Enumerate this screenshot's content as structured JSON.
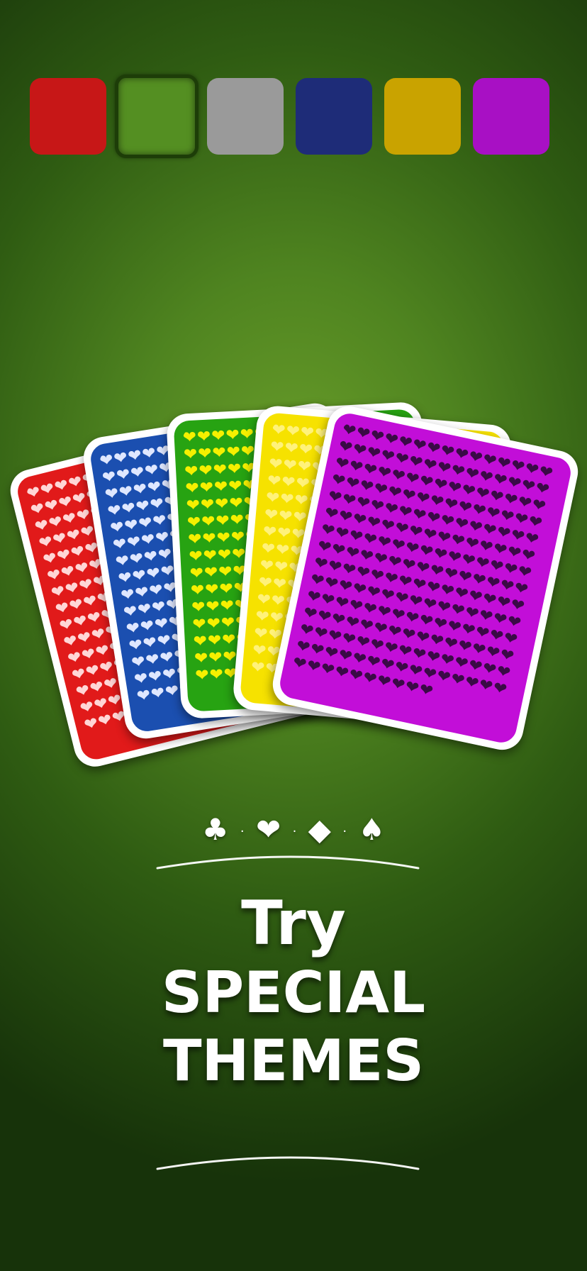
{
  "swatches": [
    {
      "name": "red",
      "color": "#c71717",
      "selected": false
    },
    {
      "name": "green",
      "color": "#548f22",
      "selected": true
    },
    {
      "name": "gray",
      "color": "#9a9a9a",
      "selected": false
    },
    {
      "name": "blue",
      "color": "#1e2c78",
      "selected": false
    },
    {
      "name": "gold",
      "color": "#c9a300",
      "selected": false
    },
    {
      "name": "purple",
      "color": "#a810c4",
      "selected": false
    }
  ],
  "cards": [
    {
      "name": "red",
      "bg": "#e11a1a",
      "pattern_color": "#ffd6d6",
      "icon": "heart-pattern-icon"
    },
    {
      "name": "blue",
      "bg": "#1b4fb0",
      "pattern_color": "#dfe7ff",
      "icon": "heart-pattern-icon"
    },
    {
      "name": "green",
      "bg": "#27a312",
      "pattern_color": "#f6f000",
      "icon": "heart-pattern-icon"
    },
    {
      "name": "yellow",
      "bg": "#f6e200",
      "pattern_color": "#fff27a",
      "icon": "heart-pattern-icon"
    },
    {
      "name": "purple",
      "bg": "#c20ed8",
      "pattern_color": "#3a0a46",
      "icon": "heart-pattern-icon"
    }
  ],
  "suits": {
    "club": "♣",
    "heart": "❤",
    "diamond": "◆",
    "spade": "♠",
    "separator": "·"
  },
  "title": {
    "line1": "Try",
    "line2": "SPECIAL",
    "line3": "THEMES"
  }
}
